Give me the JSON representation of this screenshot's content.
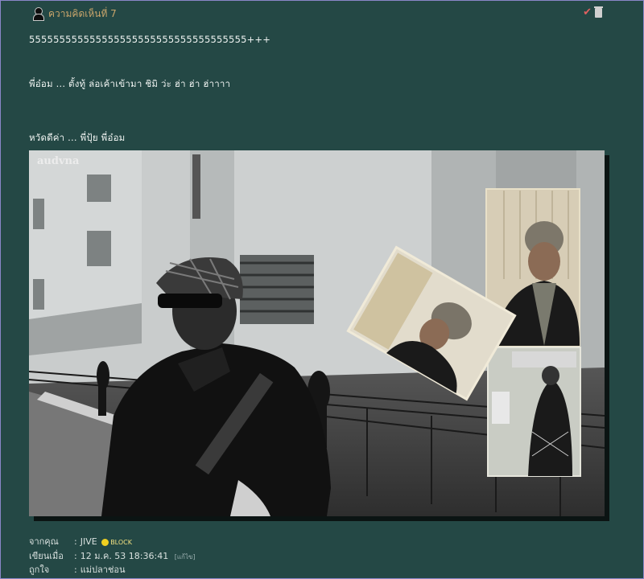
{
  "comment": {
    "title": "ความคิดเห็นที่ 7",
    "lines": [
      "555555555555555555555555555555555555+++",
      "พี่อ๋อม ... ตั้งทู้ ล่อเค้าเข้ามา ชิมิ  ว่ะ ฮ่า ฮ่า ฮ่าาาา",
      "หวัดดีค่า ... พี่ปุ้ย  พี่อ๋อม"
    ],
    "photo_watermark": "audvna"
  },
  "meta": {
    "from_label": "จากคุณ",
    "from_value": "JIVE",
    "from_badge": "BLOCK",
    "posted_label": "เขียนเมื่อ",
    "posted_value": "12 ม.ค. 53 18:36:41",
    "posted_link": "[แก้ไข]",
    "like_label": "ถูกใจ",
    "like_value": "แม่ปลาช่อน"
  },
  "colors": {
    "background": "#244845",
    "title": "#c9a56b",
    "border": "#8a86c8"
  },
  "icons": [
    "avatar-icon",
    "check-icon",
    "trash-icon",
    "smile-icon",
    "block-icon"
  ]
}
